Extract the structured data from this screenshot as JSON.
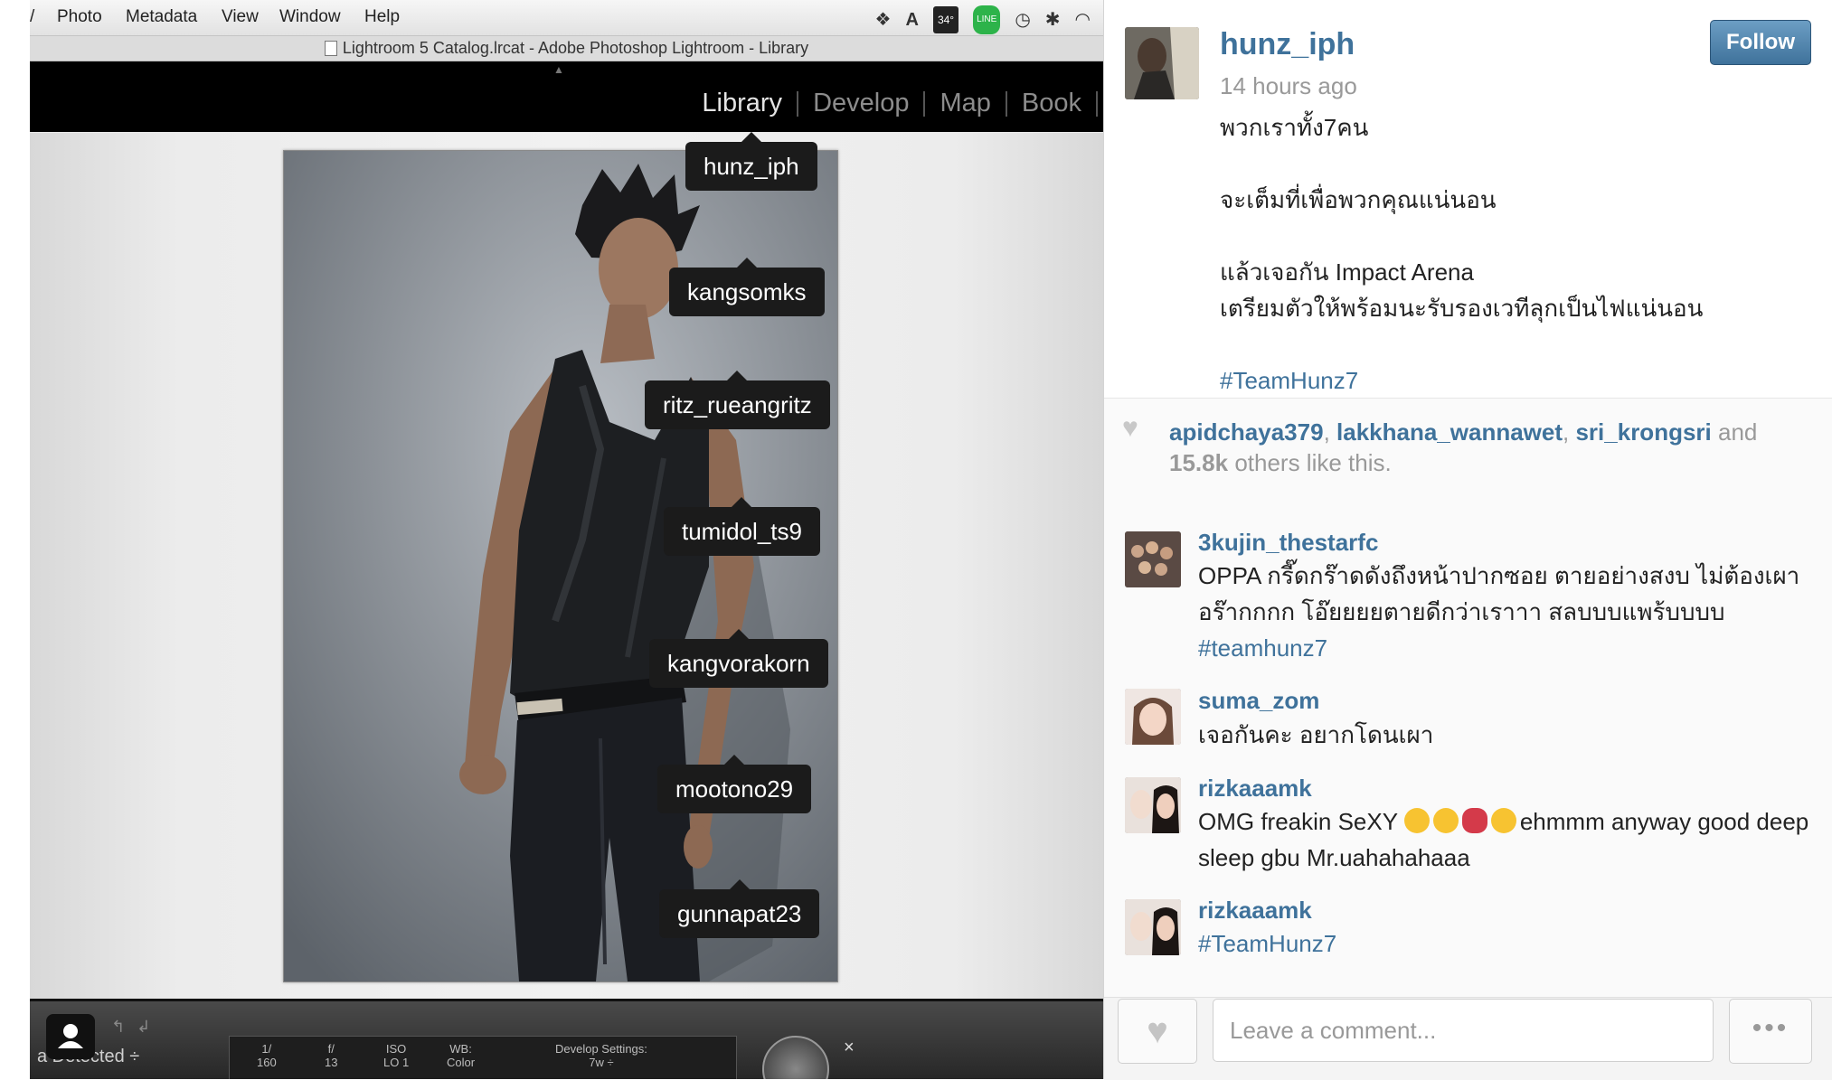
{
  "app": {
    "menu_items": [
      "Photo",
      "Metadata",
      "View",
      "Window",
      "Help"
    ],
    "window_title": "Lightroom 5 Catalog.lrcat - Adobe Photoshop Lightroom - Library",
    "battery": "34°",
    "modules": [
      "Library",
      "Develop",
      "Map",
      "Book"
    ],
    "tags": [
      "hunz_iph",
      "kangsomks",
      "ritz_rueangritz",
      "tumidol_ts9",
      "kangvorakorn",
      "mootono29",
      "gunnapat23"
    ],
    "filmstrip": {
      "label": "a Detected ÷",
      "cols": [
        "1/\n160",
        "f/\n13",
        "ISO\nLO 1",
        "WB:\nColor",
        "Develop Settings:\n7w ÷"
      ],
      "close": "×"
    }
  },
  "post": {
    "username": "hunz_iph",
    "follow_label": "Follow",
    "time": "14 hours ago",
    "caption_lines": [
      "พวกเราทั้ง7คน",
      "",
      "จะเต็มที่เพื่อพวกคุณแน่นอน",
      "",
      "แล้วเจอกัน Impact Arena",
      "เตรียมตัวให้พร้อมนะรับรองเวทีลุกเป็นไฟแน่นอน",
      ""
    ],
    "caption_hashtag": "#TeamHunz7",
    "likes": {
      "users": [
        "apidchaya379",
        "lakkhana_wannawet",
        "sri_krongsri"
      ],
      "and": "and",
      "count": "15.8k",
      "suffix": "others like this."
    },
    "comments": [
      {
        "user": "3kujin_thestarfc",
        "text": "OPPA กรี๊ดกร๊าดดังถึงหน้าปากซอย ตายอย่างสงบ ไม่ต้องเผา อร๊ากกกก โอ๊ยยยยตายดีกว่าเราาา สลบบบแพร้บบบบ",
        "tag": "#teamhunz7"
      },
      {
        "user": "suma_zom",
        "text": "เจอกันคะ อยากโดนเผา"
      },
      {
        "user": "rizkaaamk",
        "text_a": "OMG freakin SeXY",
        "text_b": "ehmmm anyway good deep sleep gbu Mr.uahahahaaa"
      },
      {
        "user": "rizkaaamk",
        "tag": "#TeamHunz7"
      }
    ],
    "comment_placeholder": "Leave a comment...",
    "more_label": "•••"
  },
  "colors": {
    "link": "#3f729b",
    "follow_button": "#3f729b",
    "tooltip": "#1b1b1b"
  },
  "icons": [
    "dropbox-icon",
    "adobe-icon",
    "line-icon",
    "time-machine-icon",
    "bluetooth-icon",
    "wifi-icon",
    "heart-icon",
    "more-icon",
    "person-icon"
  ]
}
